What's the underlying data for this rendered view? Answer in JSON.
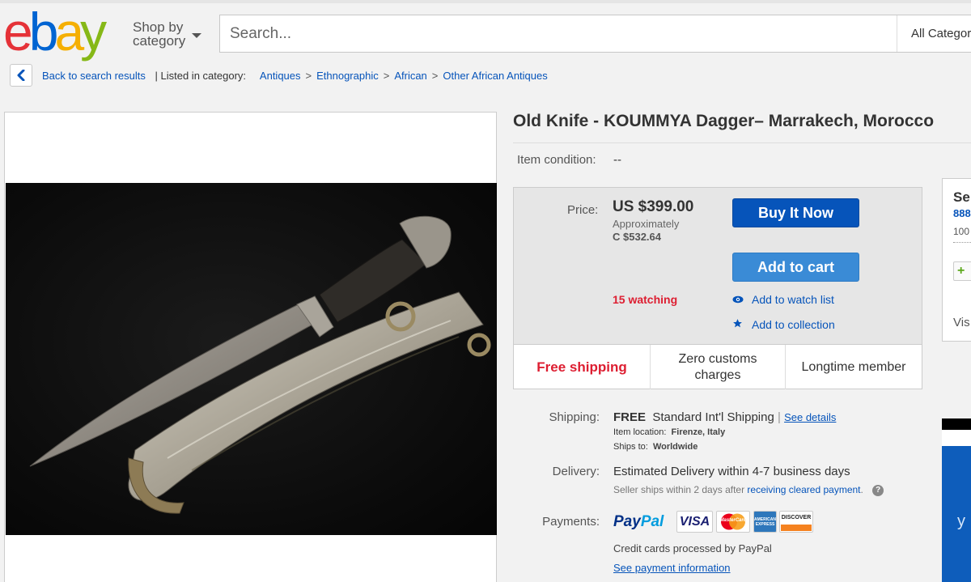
{
  "header": {
    "logo_letters": [
      "e",
      "b",
      "a",
      "y"
    ],
    "logo_colors": [
      "#e53238",
      "#0064d2",
      "#f5af02",
      "#86b817"
    ],
    "shop_by": "Shop by",
    "category": "category",
    "search_placeholder": "Search...",
    "category_select": "All Categories"
  },
  "breadcrumb": {
    "back": "Back to search results",
    "listed_in": "| Listed in category:",
    "crumbs": [
      "Antiques",
      "Ethnographic",
      "African",
      "Other African Antiques"
    ],
    "separator": ">"
  },
  "item": {
    "title": "Old Knife - KOUMMYA Dagger– Marrakech, Morocco",
    "condition_label": "Item condition:",
    "condition_value": "--"
  },
  "price": {
    "label": "Price:",
    "value": "US $399.00",
    "approx_label": "Approximately",
    "approx_value": "C $532.64",
    "buy_now": "Buy It Now",
    "add_to_cart": "Add to cart",
    "watching": "15 watching",
    "watch_list": "Add to watch list",
    "collection": "Add to collection"
  },
  "features": [
    "Free shipping",
    "Zero customs charges",
    "Longtime member"
  ],
  "shipping": {
    "label": "Shipping:",
    "free": "FREE",
    "service": "Standard Int'l Shipping",
    "pipe": "|",
    "see_details": "See details",
    "location_label": "Item location:",
    "location_value": "Firenze, Italy",
    "ships_to_label": "Ships to:",
    "ships_to_value": "Worldwide"
  },
  "delivery": {
    "label": "Delivery:",
    "estimate": "Estimated Delivery within 4-7 business days",
    "note": "Seller ships within 2 days after",
    "note_link": "receiving cleared payment",
    "note_end": ".",
    "help": "?"
  },
  "payments": {
    "label": "Payments:",
    "paypal_pay": "Pay",
    "paypal_pal": "Pal",
    "visa": "VISA",
    "mastercard": "MasterCard",
    "amex": "AMERICAN EXPRESS",
    "discover": "DISCOVER",
    "cc_note": "Credit cards processed by PayPal",
    "see_info": "See payment information"
  },
  "seller": {
    "heading": "Se",
    "id": "888",
    "pct": "100",
    "plus": "+",
    "visit": "Vis"
  },
  "ad": {
    "text": "y"
  }
}
